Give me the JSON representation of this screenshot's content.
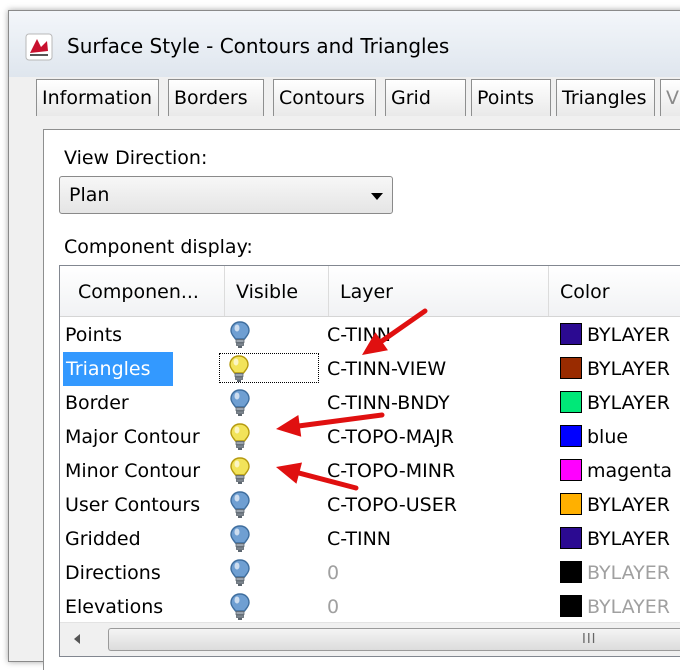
{
  "window": {
    "title": "Surface Style - Contours and Triangles"
  },
  "tabs": [
    {
      "label": "Information"
    },
    {
      "label": "Borders"
    },
    {
      "label": "Contours"
    },
    {
      "label": "Grid"
    },
    {
      "label": "Points"
    },
    {
      "label": "Triangles"
    },
    {
      "label": "V"
    }
  ],
  "view_direction": {
    "label": "View Direction:",
    "value": "Plan"
  },
  "component_display": {
    "label": "Component display:",
    "columns": [
      "Componen...",
      "Visible",
      "Layer",
      "Color"
    ],
    "rows": [
      {
        "name": "Points",
        "visible": true,
        "bulb": "on",
        "layer": "C-TINN",
        "color_name": "BYLAYER",
        "swatch": "#2b0a91"
      },
      {
        "name": "Triangles",
        "visible": false,
        "bulb": "off",
        "layer": "C-TINN-VIEW",
        "color_name": "BYLAYER",
        "swatch": "#992b00"
      },
      {
        "name": "Border",
        "visible": true,
        "bulb": "on",
        "layer": "C-TINN-BNDY",
        "color_name": "BYLAYER",
        "swatch": "#00e878"
      },
      {
        "name": "Major Contour",
        "visible": false,
        "bulb": "off",
        "layer": "C-TOPO-MAJR",
        "color_name": "blue",
        "swatch": "#0000ff"
      },
      {
        "name": "Minor Contour",
        "visible": false,
        "bulb": "off",
        "layer": "C-TOPO-MINR",
        "color_name": "magenta",
        "swatch": "#ff00ff"
      },
      {
        "name": "User Contours",
        "visible": true,
        "bulb": "on",
        "layer": "C-TOPO-USER",
        "color_name": "BYLAYER",
        "swatch": "#ffb000"
      },
      {
        "name": "Gridded",
        "visible": true,
        "bulb": "on",
        "layer": "C-TINN",
        "color_name": "BYLAYER",
        "swatch": "#2b0a91"
      },
      {
        "name": "Directions",
        "visible": true,
        "bulb": "on",
        "layer": "0",
        "color_name": "BYLAYER",
        "swatch": "#000000",
        "disabled": true
      },
      {
        "name": "Elevations",
        "visible": true,
        "bulb": "on",
        "layer": "0",
        "color_name": "BYLAYER",
        "swatch": "#000000",
        "disabled": true
      }
    ],
    "selected_row": "Triangles"
  },
  "scrollbar": {
    "grip": "III"
  },
  "colors": {
    "selection": "#3399ff",
    "bulb_on": "#6f9fd2",
    "bulb_off": "#f2e35a",
    "arrow": "#e01010"
  }
}
